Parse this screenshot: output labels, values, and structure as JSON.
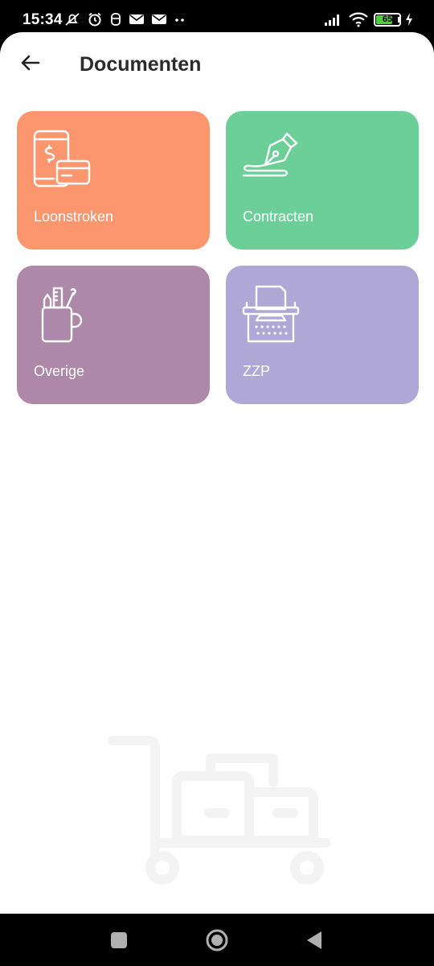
{
  "status_bar": {
    "time": "15:34",
    "battery_level": "65",
    "icons_left": [
      "silent-icon",
      "alarm-icon",
      "notification-icon",
      "mail-icon",
      "mail-icon",
      "more-icon"
    ],
    "icons_right": [
      "signal-icon",
      "wifi-icon",
      "battery-icon",
      "charging-icon"
    ]
  },
  "header": {
    "title": "Documenten",
    "back_icon": "arrow-left-icon"
  },
  "tiles": [
    {
      "label": "Loonstroken",
      "color": "#fb966f",
      "icon": "phone-payment-icon"
    },
    {
      "label": "Contracten",
      "color": "#6ccf98",
      "icon": "pen-signature-icon"
    },
    {
      "label": "Overige",
      "color": "#ad88a8",
      "icon": "pencil-cup-icon"
    },
    {
      "label": "ZZP",
      "color": "#afa7d6",
      "icon": "typewriter-icon"
    }
  ],
  "nav_bar": {
    "buttons": [
      "recents-icon",
      "home-icon",
      "back-icon"
    ]
  }
}
